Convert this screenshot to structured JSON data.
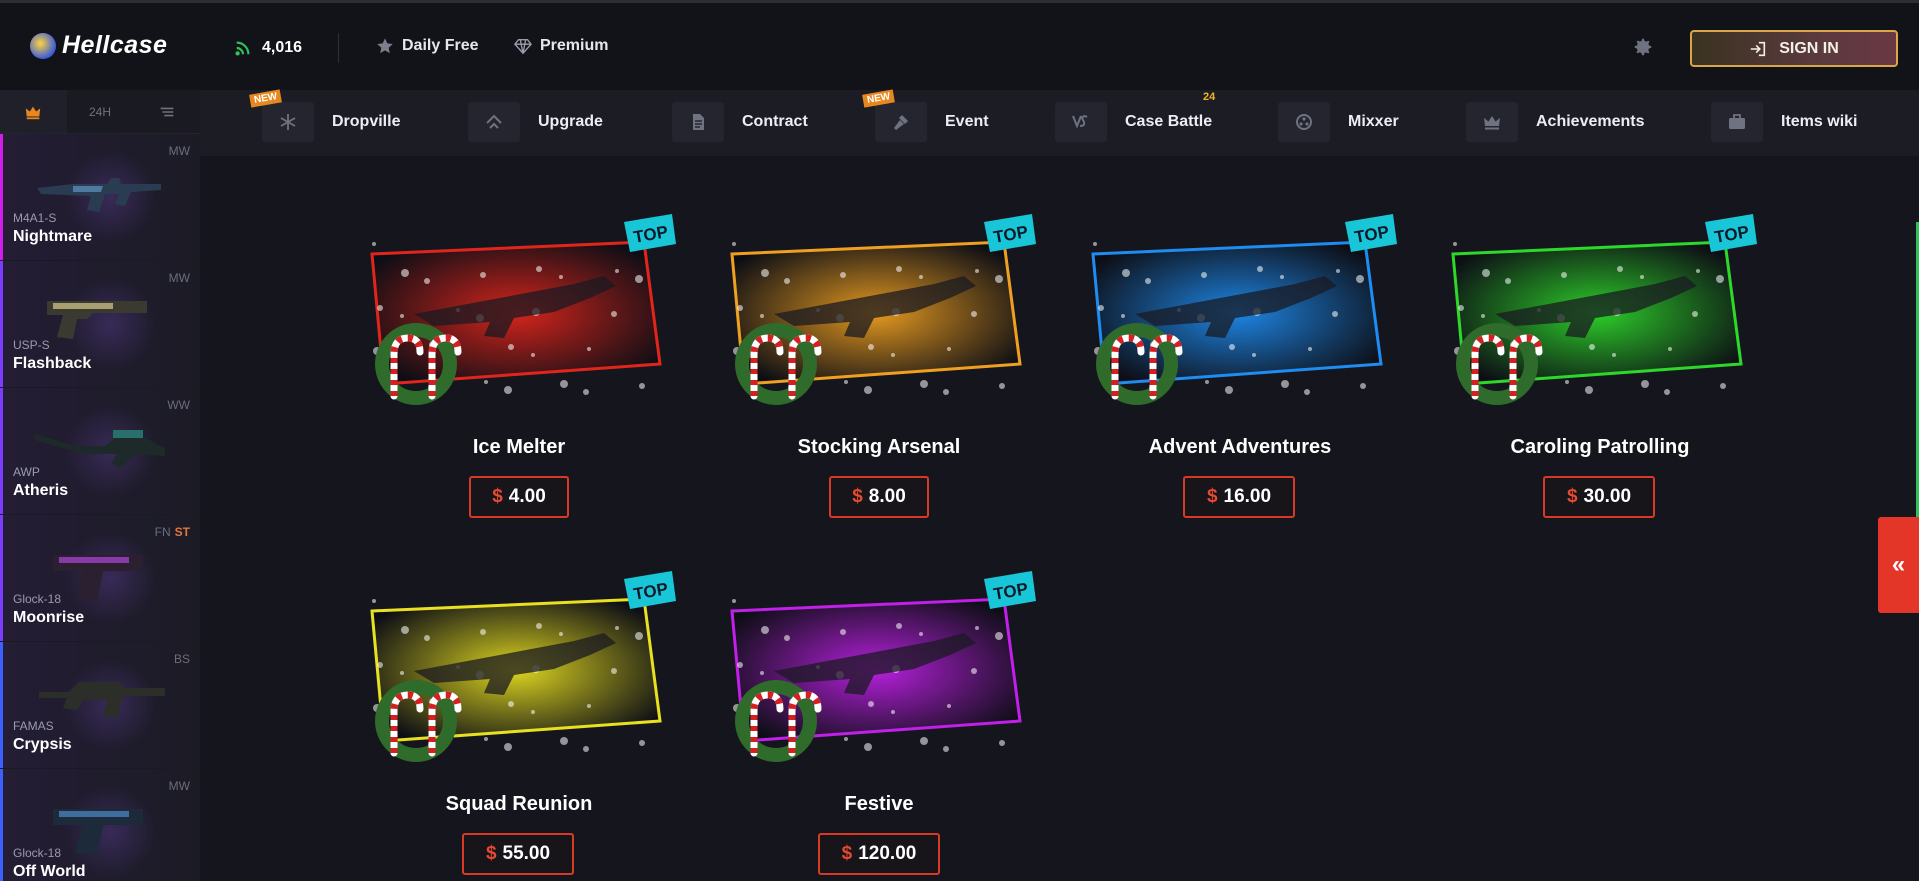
{
  "header": {
    "logo_text": "Hellcase",
    "online_count": "4,016",
    "daily_free": "Daily Free",
    "premium": "Premium",
    "signin": "SIGN IN",
    "brand_color": "#d8a848",
    "accent_red": "#e33628"
  },
  "sidebar": {
    "tabs": [
      {
        "label": "",
        "icon": "crown-icon"
      },
      {
        "label": "24H",
        "icon": ""
      },
      {
        "label": "",
        "icon": "list-icon"
      }
    ],
    "drops": [
      {
        "weapon": "M4A1-S",
        "skin": "Nightmare",
        "wear": "MW",
        "st": "",
        "rarity_color": "#d21ee8"
      },
      {
        "weapon": "USP-S",
        "skin": "Flashback",
        "wear": "MW",
        "st": "",
        "rarity_color": "#7b3cff"
      },
      {
        "weapon": "AWP",
        "skin": "Atheris",
        "wear": "WW",
        "st": "",
        "rarity_color": "#7b3cff"
      },
      {
        "weapon": "Glock-18",
        "skin": "Moonrise",
        "wear": "FN",
        "st": "ST",
        "rarity_color": "#7b3cff"
      },
      {
        "weapon": "FAMAS",
        "skin": "Crypsis",
        "wear": "BS",
        "st": "",
        "rarity_color": "#3a60ff"
      },
      {
        "weapon": "Glock-18",
        "skin": "Off World",
        "wear": "MW",
        "st": "",
        "rarity_color": "#3a60ff"
      }
    ]
  },
  "nav": {
    "items": [
      {
        "label": "Dropville",
        "icon": "snowflake-icon",
        "badge": "NEW",
        "count": ""
      },
      {
        "label": "Upgrade",
        "icon": "upgrade-icon",
        "badge": "",
        "count": ""
      },
      {
        "label": "Contract",
        "icon": "document-icon",
        "badge": "",
        "count": ""
      },
      {
        "label": "Event",
        "icon": "hammer-icon",
        "badge": "NEW",
        "count": ""
      },
      {
        "label": "Case Battle",
        "icon": "versus-icon",
        "badge": "",
        "count": "24"
      },
      {
        "label": "Mixxer",
        "icon": "mixer-icon",
        "badge": "",
        "count": ""
      },
      {
        "label": "Achievements",
        "icon": "crown-icon",
        "badge": "",
        "count": ""
      },
      {
        "label": "Items wiki",
        "icon": "briefcase-icon",
        "badge": "",
        "count": ""
      }
    ]
  },
  "cases": [
    {
      "name": "Ice Melter",
      "currency": "$",
      "price": "4.00",
      "tag": "TOP",
      "theme": "#e0251c"
    },
    {
      "name": "Stocking Arsenal",
      "currency": "$",
      "price": "8.00",
      "tag": "TOP",
      "theme": "#f0a020"
    },
    {
      "name": "Advent Adventures",
      "currency": "$",
      "price": "16.00",
      "tag": "TOP",
      "theme": "#1e8cf0"
    },
    {
      "name": "Caroling Patrolling",
      "currency": "$",
      "price": "30.00",
      "tag": "TOP",
      "theme": "#2ed82a"
    },
    {
      "name": "Squad Reunion",
      "currency": "$",
      "price": "55.00",
      "tag": "TOP",
      "theme": "#e8e020"
    },
    {
      "name": "Festive",
      "currency": "$",
      "price": "120.00",
      "tag": "TOP",
      "theme": "#c020e8"
    }
  ],
  "panel_toggle": "«"
}
